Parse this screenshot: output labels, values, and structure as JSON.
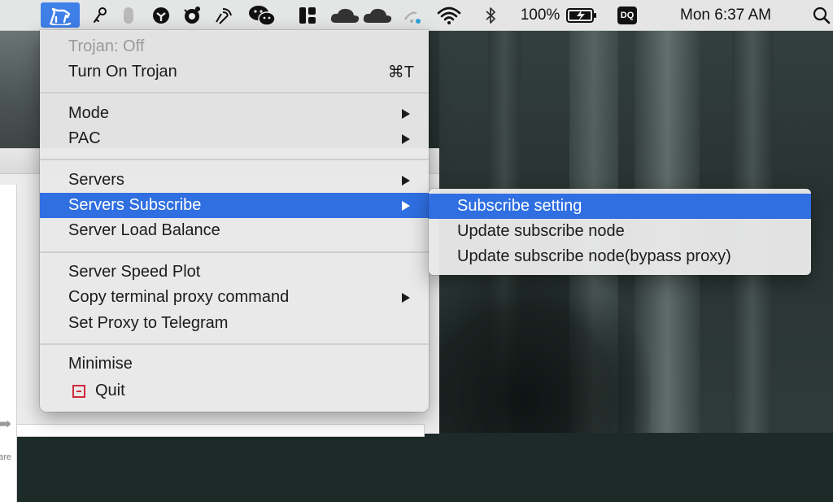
{
  "menubar": {
    "battery_percent": "100%",
    "dq_label": "DQ",
    "clock": "Mon 6:37 AM",
    "status_icons": [
      "trojan-app-icon",
      "key-icon",
      "mouse-icon",
      "rotate-icon",
      "bug-icon",
      "satellite-icon",
      "wechat-icon",
      "panels-icon",
      "cloud-icon",
      "cloud-icon",
      "wifi-dots-icon",
      "wifi-icon",
      "bluetooth-icon",
      "battery-charging-icon",
      "dq-icon",
      "search-icon"
    ]
  },
  "menu": {
    "status": "Trojan: Off",
    "turn_on": "Turn On Trojan",
    "turn_on_shortcut": "⌘T",
    "mode": "Mode",
    "pac": "PAC",
    "servers": "Servers",
    "servers_subscribe": "Servers Subscribe",
    "server_load_balance": "Server Load Balance",
    "server_speed_plot": "Server Speed Plot",
    "copy_terminal_proxy": "Copy terminal proxy command",
    "set_proxy_telegram": "Set Proxy to Telegram",
    "minimise": "Minimise",
    "quit": "Quit"
  },
  "submenu": {
    "subscribe_setting": "Subscribe setting",
    "update_subscribe_node": "Update subscribe node",
    "update_subscribe_node_bypass": "Update subscribe node(bypass proxy)"
  },
  "background_window": {
    "share_label": "are"
  },
  "colors": {
    "highlight": "#2f6fe1",
    "menubar_app_highlight": "#3f7fe8",
    "quit_icon": "#d0283c"
  }
}
